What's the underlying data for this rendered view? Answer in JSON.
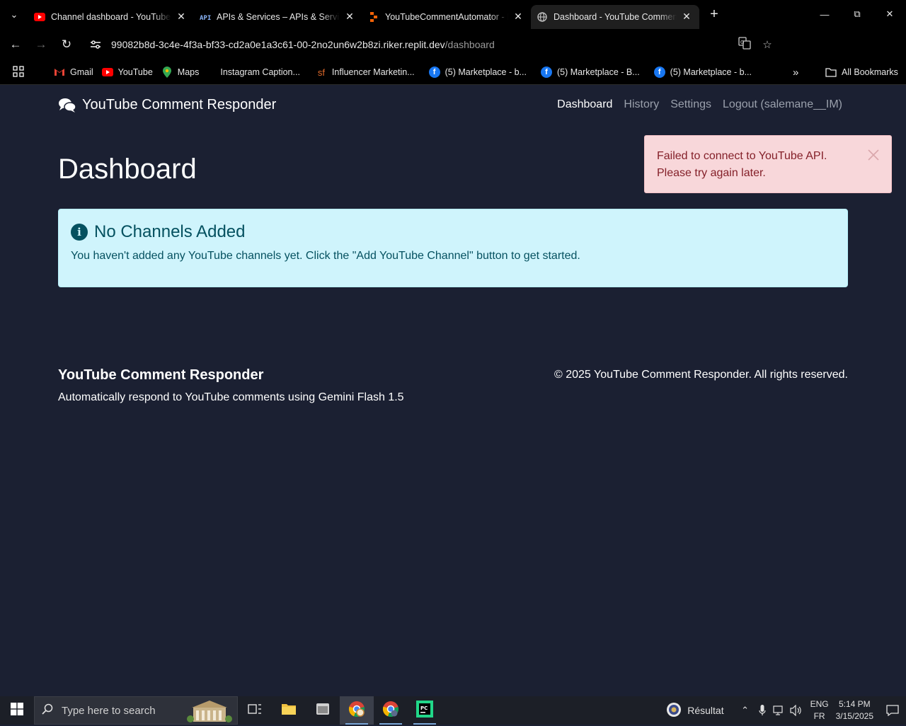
{
  "browser": {
    "tabs": [
      {
        "title": "Channel dashboard - YouTube Studio",
        "icon": "youtube-icon",
        "active": false
      },
      {
        "title": "APIs & Services – APIs & Services",
        "icon": "api-icon",
        "active": false
      },
      {
        "title": "YouTubeCommentAutomator - Replit",
        "icon": "replit-icon",
        "active": false
      },
      {
        "title": "Dashboard - YouTube Comment Responder",
        "icon": "globe-icon",
        "active": true
      }
    ],
    "url_host": "99082b8d-3c4e-4f3a-bf33-cd2a0e1a3c61-00-2no2un6w2b8zi.riker.replit.dev",
    "url_path": "/dashboard",
    "bookmarks": [
      {
        "label": "Gmail",
        "icon": "gmail-icon"
      },
      {
        "label": "YouTube",
        "icon": "youtube-icon"
      },
      {
        "label": "Maps",
        "icon": "maps-icon"
      },
      {
        "label": "Instagram Caption...",
        "icon": "blank-icon"
      },
      {
        "label": "Influencer Marketin...",
        "icon": "sf-icon"
      },
      {
        "label": "(5) Marketplace - b...",
        "icon": "facebook-icon"
      },
      {
        "label": "(5) Marketplace - B...",
        "icon": "facebook-icon"
      },
      {
        "label": "(5) Marketplace - b...",
        "icon": "facebook-icon"
      }
    ],
    "all_bookmarks_label": "All Bookmarks"
  },
  "app": {
    "brand": "YouTube Comment Responder",
    "nav": {
      "dashboard": "Dashboard",
      "history": "History",
      "settings": "Settings",
      "logout": "Logout (salemane__IM)"
    },
    "page_title": "Dashboard",
    "error_alert": {
      "line1": "Failed to connect to YouTube API.",
      "line2": "Please try again later."
    },
    "info": {
      "title": "No Channels Added",
      "message": "You haven't added any YouTube channels yet. Click the \"Add YouTube Channel\" button to get started."
    },
    "footer": {
      "title": "YouTube Comment Responder",
      "subtitle": "Automatically respond to YouTube comments using Gemini Flash 1.5",
      "copyright": "© 2025 YouTube Comment Responder. All rights reserved."
    }
  },
  "taskbar": {
    "search_placeholder": "Type here to search",
    "weather_label": "Résultat",
    "lang_top": "ENG",
    "lang_bottom": "FR",
    "time": "5:14 PM",
    "date": "3/15/2025"
  },
  "colors": {
    "page_bg": "#1b2032",
    "error_bg": "#f8d7da",
    "error_text": "#842029",
    "info_bg": "#cff4fc",
    "info_text": "#055160"
  }
}
